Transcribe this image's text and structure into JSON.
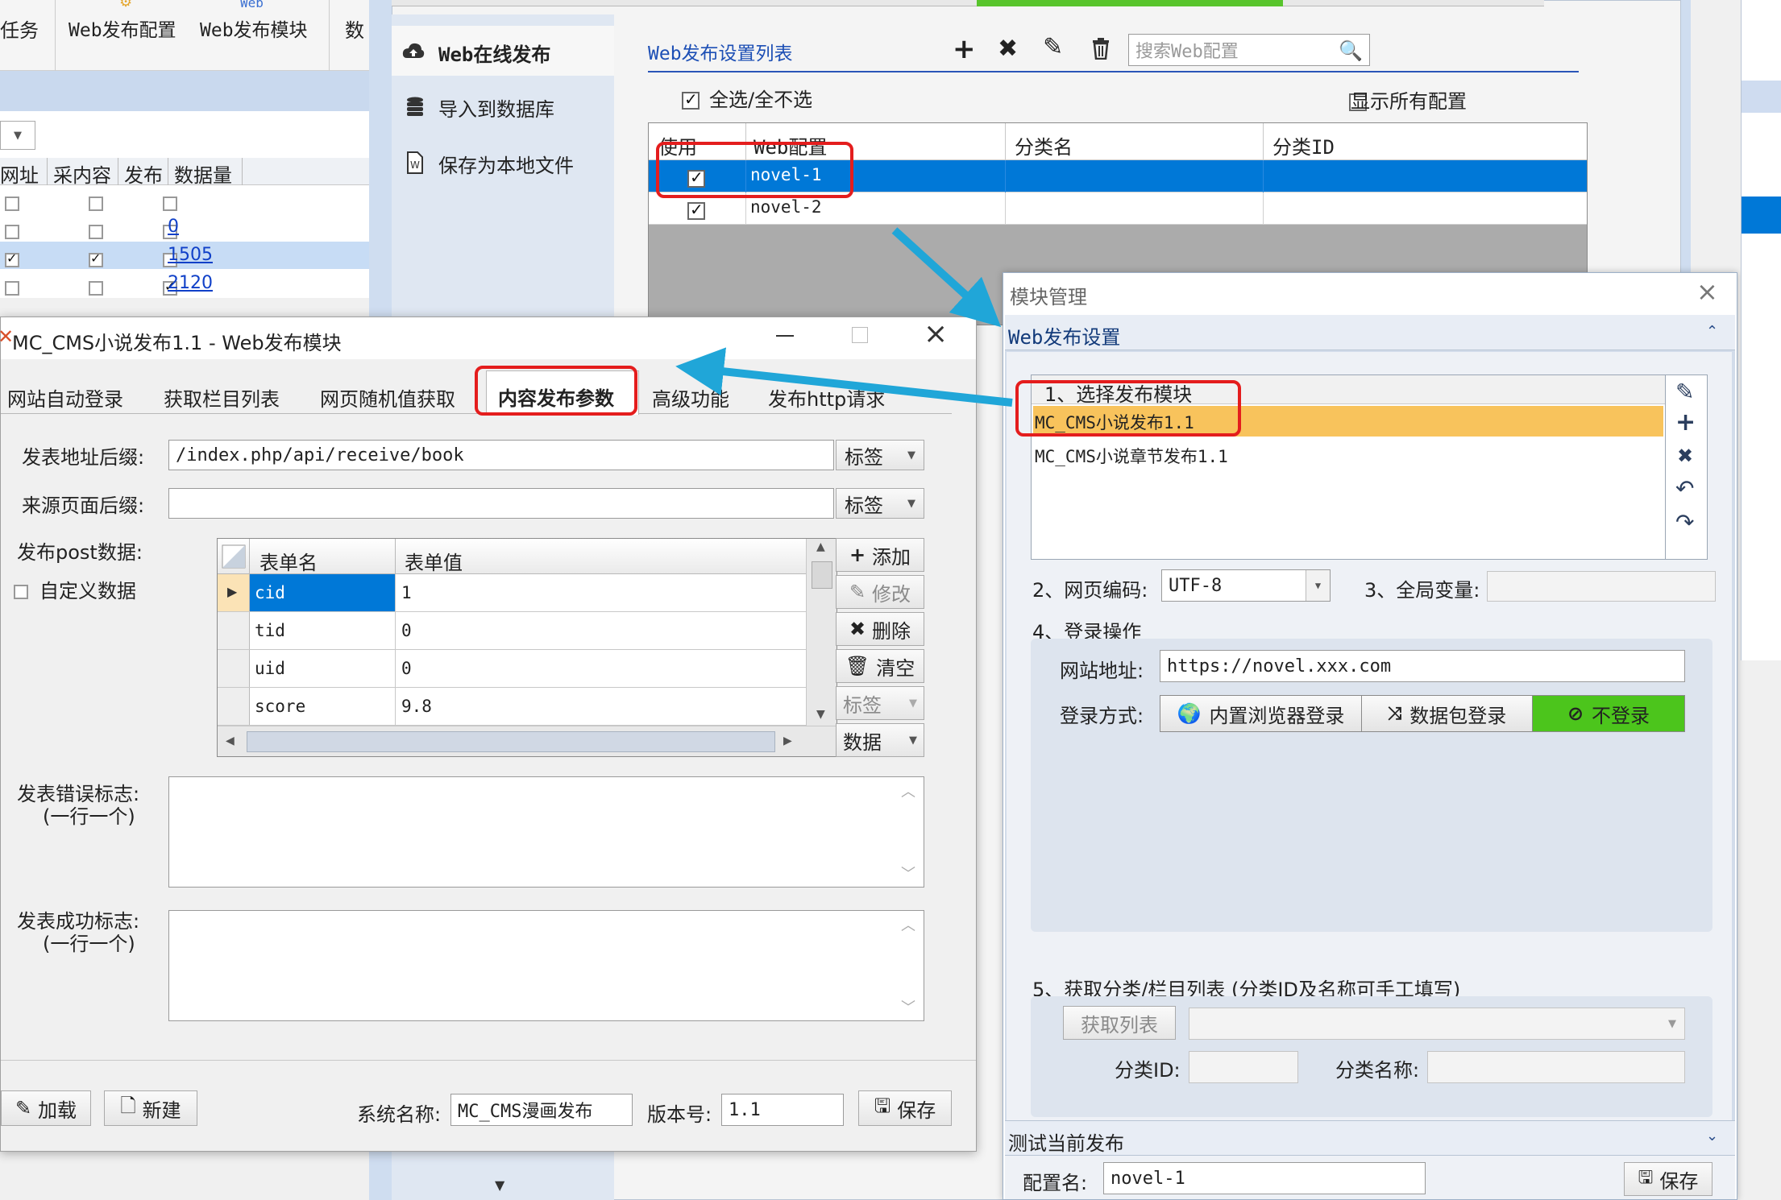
{
  "toolbar": {
    "item_task": "任务",
    "item_web_config": "Web发布配置",
    "item_web_module": "Web发布模块",
    "item_web_label_small": "Web",
    "item_data": "数"
  },
  "task_grid": {
    "headers": [
      "网址",
      "采内容",
      "发布",
      "数据量"
    ],
    "rows": [
      {
        "c1": false,
        "c2": false,
        "c3": false,
        "count": ""
      },
      {
        "c1": false,
        "c2": false,
        "c3": false,
        "count": "0"
      },
      {
        "c1": true,
        "c2": true,
        "c3": false,
        "count": "1505"
      },
      {
        "c1": false,
        "c2": false,
        "c3": true,
        "count": "2120"
      }
    ]
  },
  "web_publish": {
    "side_menu": [
      {
        "label": "Web在线发布",
        "icon": "cloud-upload-icon"
      },
      {
        "label": "导入到数据库",
        "icon": "database-icon"
      },
      {
        "label": "保存为本地文件",
        "icon": "file-icon"
      }
    ],
    "list_title": "Web发布设置列表",
    "search_placeholder": "搜索Web配置",
    "select_all_label": "全选/全不选",
    "show_all_label": "显示所有配置",
    "columns": [
      "使用",
      "Web配置",
      "分类名",
      "分类ID"
    ],
    "rows": [
      {
        "use": true,
        "config": "novel-1",
        "category": "",
        "category_id": ""
      },
      {
        "use": true,
        "config": "novel-2",
        "category": "",
        "category_id": ""
      }
    ]
  },
  "module_window": {
    "title": "MC_CMS小说发布1.1 - Web发布模块",
    "tabs": [
      "网站自动登录",
      "获取栏目列表",
      "网页随机值获取",
      "内容发布参数",
      "高级功能",
      "发布http请求"
    ],
    "active_tab": "内容发布参数",
    "post_suffix_label": "发表地址后缀:",
    "post_suffix_value": "/index.php/api/receive/book",
    "referer_label": "来源页面后缀:",
    "referer_value": "",
    "tag_button": "标签",
    "post_data_label": "发布post数据:",
    "custom_data_label": "自定义数据",
    "form_table": {
      "headers": [
        "表单名",
        "表单值"
      ],
      "rows": [
        {
          "name": "cid",
          "value": "1"
        },
        {
          "name": "tid",
          "value": "0"
        },
        {
          "name": "uid",
          "value": "0"
        },
        {
          "name": "score",
          "value": "9.8"
        }
      ]
    },
    "side_buttons": {
      "add": "添加",
      "edit": "修改",
      "delete": "删除",
      "clear": "清空",
      "tag": "标签",
      "data": "数据"
    },
    "error_flag_label": "发表错误标志:",
    "error_flag_hint": "(一行一个)",
    "success_flag_label": "发表成功标志:",
    "success_flag_hint": "(一行一个)",
    "load_button": "加载",
    "new_button": "新建",
    "system_name_label": "系统名称:",
    "system_name_value": "MC_CMS漫画发布",
    "version_label": "版本号:",
    "version_value": "1.1",
    "save_button": "保存"
  },
  "module_manager": {
    "title": "模块管理",
    "section_title": "Web发布设置",
    "step1_label": "1、选择发布模块",
    "modules": [
      "MC_CMS小说发布1.1",
      "MC_CMS小说章节发布1.1"
    ],
    "selected_module": "MC_CMS小说发布1.1",
    "encoding_label": "2、网页编码:",
    "encoding_value": "UTF-8",
    "global_var_label": "3、全局变量:",
    "global_var_value": "",
    "login_section_label": "4、登录操作",
    "site_url_label": "网站地址:",
    "site_url_value": "https://novel.xxx.com",
    "login_method_label": "登录方式:",
    "login_methods": [
      "内置浏览器登录",
      "数据包登录",
      "不登录"
    ],
    "active_login_method": "不登录",
    "category_section_label": "5、获取分类/栏目列表 (分类ID及名称可手工填写)",
    "get_list_button": "获取列表",
    "category_id_label": "分类ID:",
    "category_name_label": "分类名称:",
    "test_section_title": "测试当前发布",
    "config_name_label": "配置名:",
    "config_name_value": "novel-1",
    "save_button": "保存"
  },
  "colors": {
    "selection_blue": "#0078d7",
    "highlight_orange": "#f8c35c",
    "green_button": "#4cc51c",
    "annotation_red": "#e41d1d",
    "arrow_cyan": "#20a6d8"
  }
}
